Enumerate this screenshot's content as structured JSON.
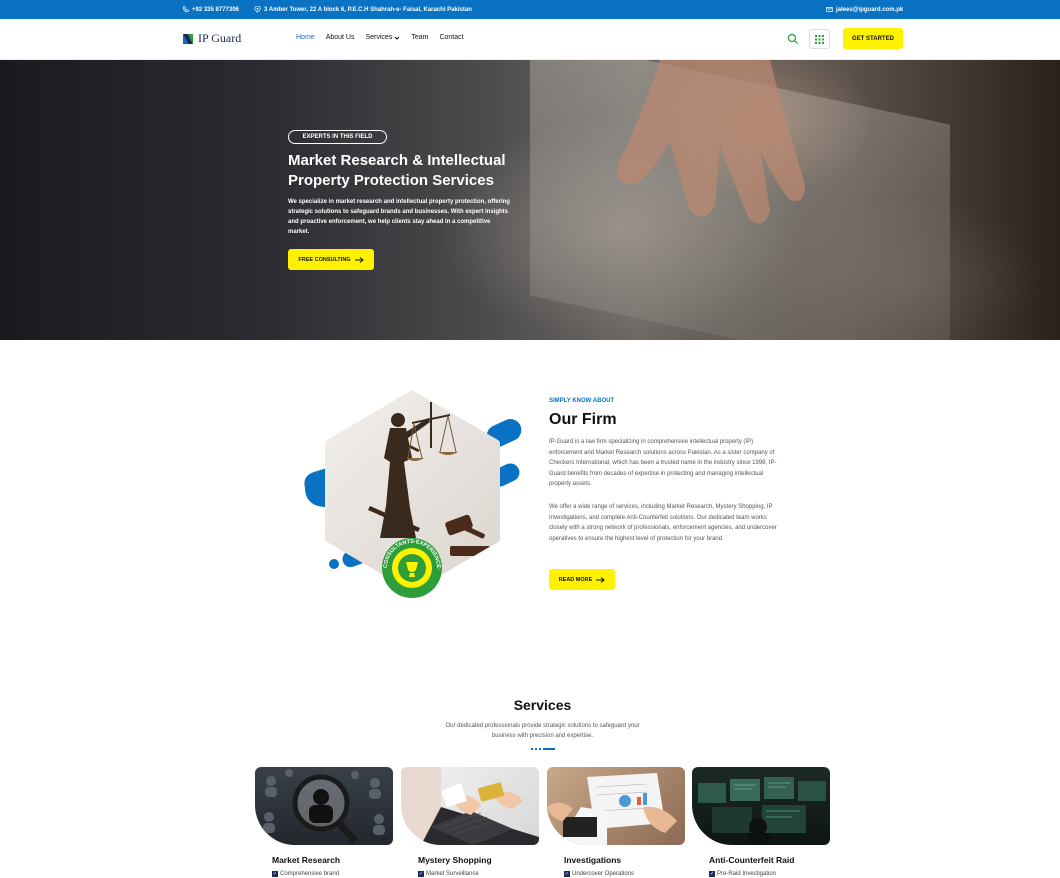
{
  "topbar": {
    "phone": "+92 335 8777306",
    "address": "3 Amber Tower, 22 A block 6, P.E.C.H Shahrah-e- Faisal, Karachi Pakistan",
    "email": "jalees@ipguard.com.pk"
  },
  "nav": {
    "logo": "IP Guard",
    "items": [
      "Home",
      "About Us",
      "Services",
      "Team",
      "Contact"
    ],
    "cta": "GET STARTED"
  },
  "hero": {
    "badge": "EXPERTS IN THIS FIELD",
    "title": "Market Research & Intellectual Property Protection Services",
    "description": "We specialize in market research and intellectual property protection, offering strategic solutions to safeguard brands and businesses. With expert insights and proactive enforcement, we help clients stay ahead in a competitive market.",
    "button": "FREE CONSULTING"
  },
  "firm": {
    "label": "SIMPLY KNOW ABOUT",
    "title": "Our Firm",
    "p1": "IP-Guard is a law firm specializing in comprehensive intellectual property (IP) enforcement and Market Research solutions across Pakistan. As a sister company of Checkers International, which has been a trusted name in the industry since 1998, IP-Guard benefits from decades of expertise in protecting and managing intellectual property assets.",
    "p2": "We offer a wide range of services, including Market Research, Mystery Shopping, IP Investigations, and complete Anti-Counterfeit solutions. Our dedicated team works closely with a strong network of professionals, enforcement agencies, and undercover operatives to ensure the highest level of protection for your brand.",
    "button": "READ MORE",
    "badge_text": "CONSULTANTS·EXPERIENCE·"
  },
  "services": {
    "title": "Services",
    "subtitle": "Our dedicated professionals provide strategic solutions to safeguard your business with precision and expertise.",
    "cards": [
      {
        "title": "Market Research",
        "item": "Comprehensive brand"
      },
      {
        "title": "Mystery Shopping",
        "item": "Market Surveillance"
      },
      {
        "title": "Investigations",
        "item": "Undercover Operations"
      },
      {
        "title": "Anti-Counterfeit Raid",
        "item": "Pre-Raid Investigation"
      }
    ]
  },
  "colors": {
    "accent": "#0a72c2",
    "cta": "#fff200",
    "navy": "#1a2a5a",
    "badge_green": "#2e9e3a"
  }
}
